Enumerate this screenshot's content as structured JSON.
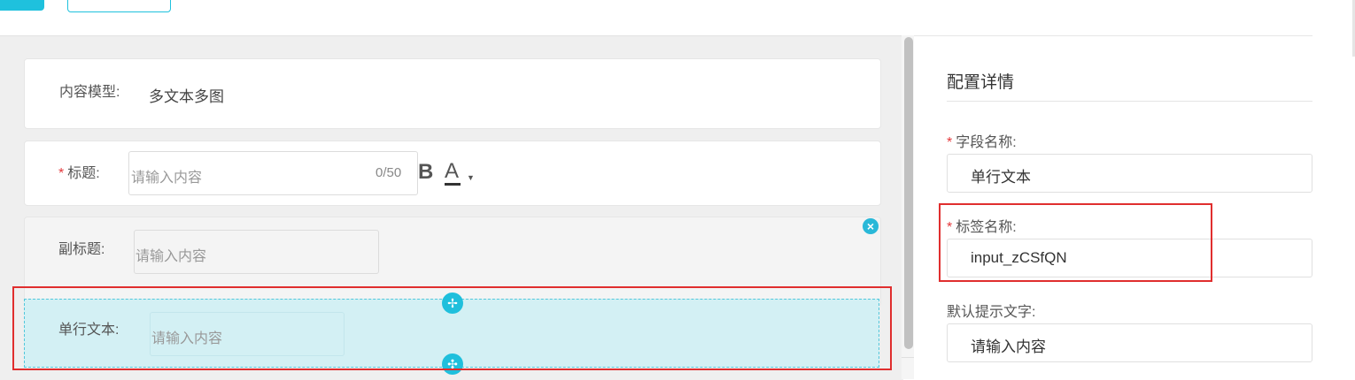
{
  "form": {
    "content_model": {
      "label": "内容模型:",
      "value": "多文本多图"
    },
    "title": {
      "required": "*",
      "label": "标题:",
      "placeholder": "请输入内容",
      "counter": "0/50",
      "bold": "B",
      "color": "A",
      "caret": "▼"
    },
    "subtitle": {
      "label": "副标题:",
      "placeholder": "请输入内容"
    },
    "single_line": {
      "label": "单行文本:",
      "placeholder": "请输入内容"
    }
  },
  "panel": {
    "title": "配置详情",
    "field_name": {
      "required": "*",
      "label": "字段名称:",
      "value": "单行文本"
    },
    "tag_name": {
      "required": "*",
      "label": "标签名称:",
      "value": "input_zCSfQN"
    },
    "default_hint": {
      "label": "默认提示文字:",
      "value": "请输入内容"
    }
  },
  "icons": {
    "remove": "close-circle-icon",
    "drag_up": "drag-handle-icon",
    "drag_down": "collapse-handle-icon"
  },
  "colors": {
    "accent": "#1fc1dd",
    "selected_bg": "#d3f0f4",
    "required": "#e4393c",
    "highlight": "#e02e2e"
  }
}
